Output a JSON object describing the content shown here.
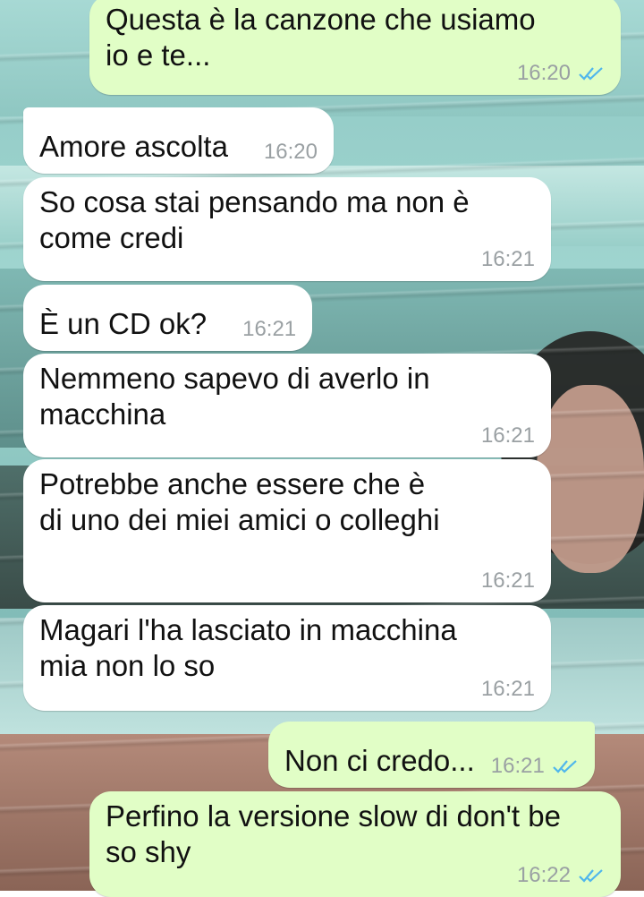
{
  "colors": {
    "incoming_bubble": "#ffffff",
    "outgoing_bubble": "#e1fec6",
    "read_ticks": "#4fb6ec",
    "timestamp": "#9aa0a3"
  },
  "messages": [
    {
      "direction": "out",
      "text": "Questa è la canzone che usiamo\nio e te...",
      "time": "16:20",
      "status": "read-ticks-icon"
    },
    {
      "direction": "in",
      "text": "Amore ascolta",
      "time": "16:20"
    },
    {
      "direction": "in",
      "text": "So cosa stai pensando ma non è\ncome credi",
      "time": "16:21"
    },
    {
      "direction": "in",
      "text": "È un CD ok?",
      "time": "16:21"
    },
    {
      "direction": "in",
      "text": "Nemmeno sapevo di averlo in\nmacchina",
      "time": "16:21"
    },
    {
      "direction": "in",
      "text": "Potrebbe anche essere che è\ndi uno dei miei amici o colleghi",
      "time": "16:21"
    },
    {
      "direction": "in",
      "text": "Magari l'ha lasciato in macchina\nmia non lo so",
      "time": "16:21"
    },
    {
      "direction": "out",
      "text": "Non ci credo...",
      "time": "16:21",
      "status": "read-ticks-icon"
    },
    {
      "direction": "out",
      "text": "Perfino la versione slow di don't be\nso shy",
      "time": "16:22",
      "status": "read-ticks-icon"
    }
  ]
}
